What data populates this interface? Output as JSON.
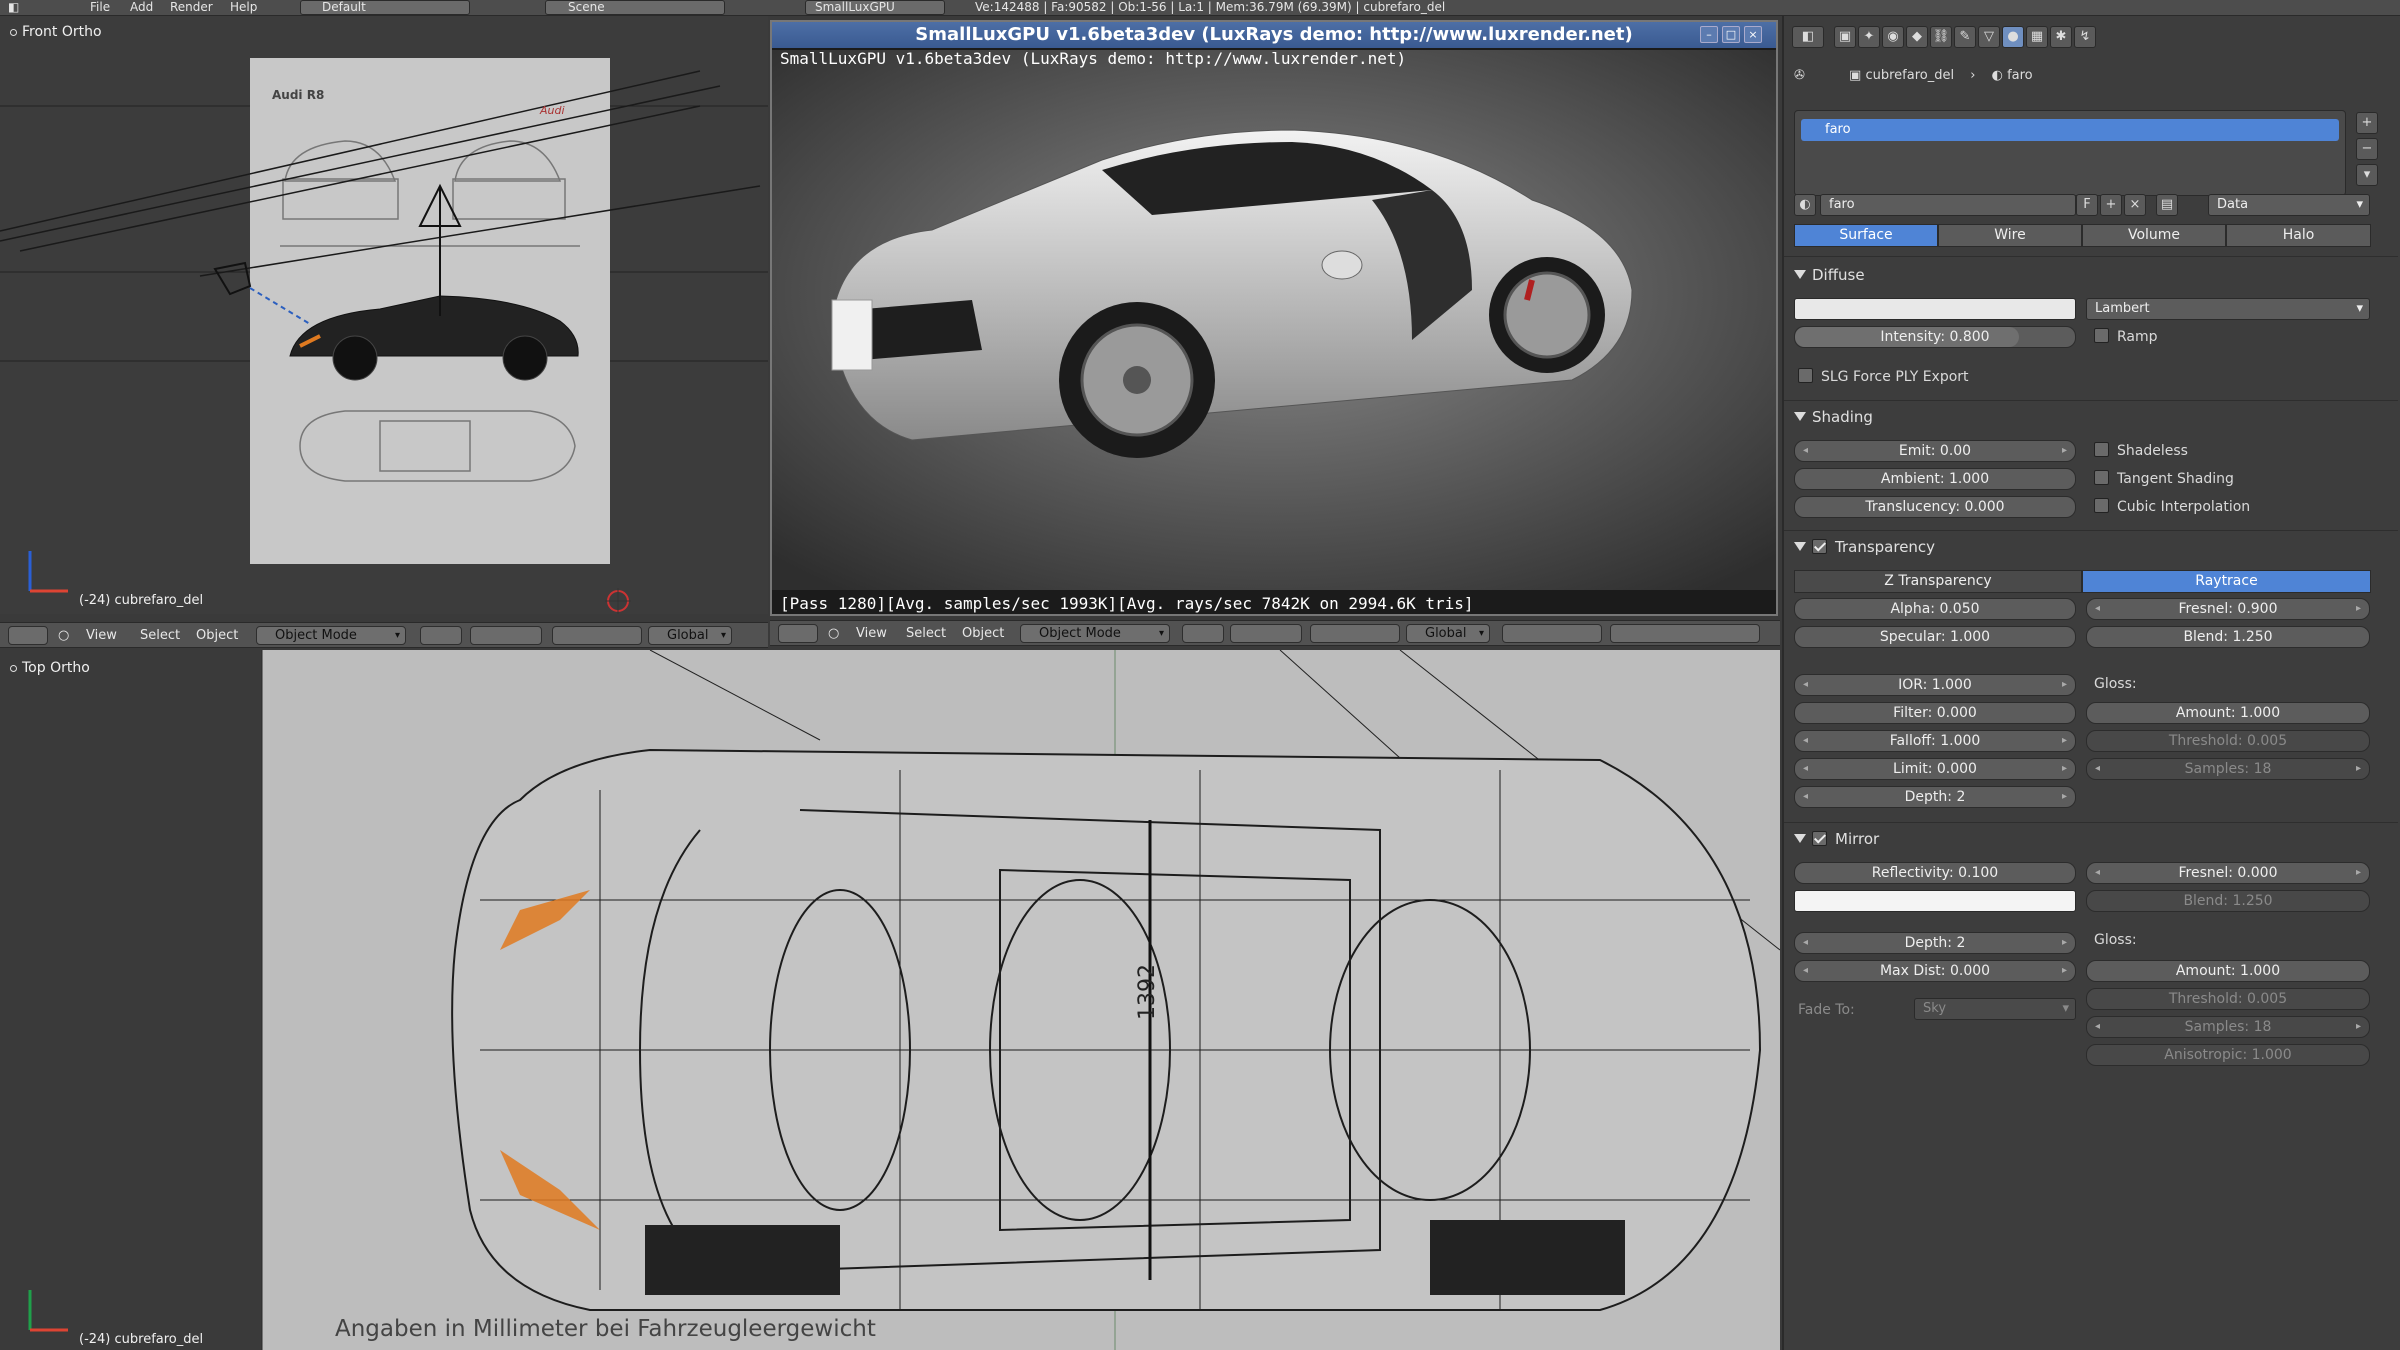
{
  "topbar": {
    "menu": [
      "File",
      "Add",
      "Render",
      "Help"
    ],
    "layout": "Default",
    "scene": "Scene",
    "engine": "SmallLuxGPU",
    "stats": "Ve:142488 | Fa:90582 | Ob:1-56 | La:1 | Mem:36.79M (69.39M) | cubrefaro_del"
  },
  "front_view": {
    "label": "Front Ortho",
    "object_label": "(-24) cubrefaro_del",
    "blueprint_title": "Audi R8",
    "blueprint_logo": "Audi"
  },
  "top_view": {
    "label": "Top Ortho",
    "object_label": "(-24) cubrefaro_del",
    "caption": "Angaben in Millimeter bei Fahrzeugleergewicht",
    "dimension": "1392"
  },
  "headers": {
    "view": "View",
    "select": "Select",
    "object": "Object",
    "mode": "Object Mode",
    "orientation": "Global"
  },
  "render_window": {
    "title": "SmallLuxGPU v1.6beta3dev (LuxRays demo: http://www.luxrender.net)",
    "text": "SmallLuxGPU v1.6beta3dev (LuxRays demo: http://www.luxrender.net)",
    "status": "[Pass 1280][Avg. samples/sec  1993K][Avg. rays/sec  7842K on 2994.6K tris]"
  },
  "properties": {
    "breadcrumb_object": "cubrefaro_del",
    "breadcrumb_material": "faro",
    "slot_name": "faro",
    "material_name": "faro",
    "fake_user": "F",
    "link": "Data",
    "tabs": [
      "Surface",
      "Wire",
      "Volume",
      "Halo"
    ],
    "diffuse": {
      "title": "Diffuse",
      "shader": "Lambert",
      "intensity": "Intensity: 0.800",
      "intensity_value": 0.8,
      "ramp": "Ramp",
      "slg": "SLG Force PLY Export"
    },
    "shading": {
      "title": "Shading",
      "emit": "Emit: 0.00",
      "ambient": "Ambient: 1.000",
      "translucency": "Translucency: 0.000",
      "shadeless": "Shadeless",
      "tangent": "Tangent Shading",
      "cubic": "Cubic Interpolation"
    },
    "transparency": {
      "title": "Transparency",
      "ztransp": "Z Transparency",
      "raytrace": "Raytrace",
      "alpha": "Alpha: 0.050",
      "fresnel": "Fresnel: 0.900",
      "specular": "Specular: 1.000",
      "blend": "Blend: 1.250",
      "ior": "IOR: 1.000",
      "filter": "Filter: 0.000",
      "falloff": "Falloff: 1.000",
      "limit": "Limit: 0.000",
      "depth": "Depth: 2",
      "gloss": "Gloss:",
      "amount": "Amount: 1.000",
      "threshold": "Threshold: 0.005",
      "samples": "Samples: 18"
    },
    "mirror": {
      "title": "Mirror",
      "reflectivity": "Reflectivity: 0.100",
      "fresnel": "Fresnel: 0.000",
      "blend": "Blend: 1.250",
      "depth": "Depth: 2",
      "maxdist": "Max Dist: 0.000",
      "fade_label": "Fade To:",
      "fade_value": "Sky",
      "gloss": "Gloss:",
      "amount": "Amount: 1.000",
      "threshold": "Threshold: 0.005",
      "samples": "Samples: 18",
      "anisotropic": "Anisotropic: 1.000"
    }
  },
  "colors": {
    "accent": "#4f84d6",
    "panel": "#3d3d3d",
    "viewport": "#3a3a3a",
    "wire_highlight": "#e07a20"
  }
}
